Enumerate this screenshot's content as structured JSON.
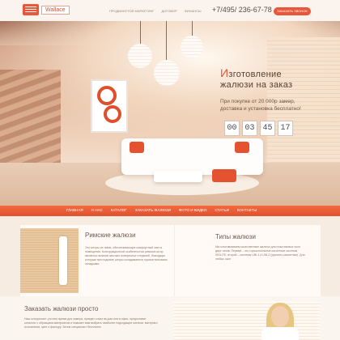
{
  "header": {
    "logo_text": "Wallace",
    "nav": [
      "ПРОДВИНУТОЙ МАРКЕТИНГ",
      "ДОГОВОР",
      "ФИНАНСЫ"
    ],
    "phone": "+7/495/ 236-67-78",
    "call_button": "ЗАКАЗАТЬ ЗВОНОК"
  },
  "hero": {
    "title_line1_accent": "И",
    "title_line1_rest": "зготовление",
    "title_line2": "жалюзи на заказ",
    "subtitle": "При покупке от 20 000р замер, доставка и установка бесплатно!",
    "timer": [
      "00",
      "03",
      "45",
      "17"
    ]
  },
  "mainnav": {
    "items": [
      "ГЛАВНАЯ",
      "О НАС",
      "КАТАЛОГ",
      "ЗАКАЗАТЬ ЖАЛЮЗИ",
      "ФОТО И ВИДЕО",
      "СТАТЬИ",
      "КОНТАКТЫ"
    ]
  },
  "roman": {
    "title": "Римские жалюзи",
    "text": "Это шторы из ткани, обеспечивающие комфортный свет в помещении. Конструкционной особенностью римских штор является наличие жестких поперечных стержней, благодаря которым при подъеме шторы складываются горизонтальными складками."
  },
  "types": {
    "title": "Типы жалюзи",
    "text": "Мы изготавливаем качественные жалюзи для пластиковых окон двух типов. Первый – это горизонтальные кассетные системы ISOLITE, второй – системы UNI-1 и UNI-2 (рулонно-кассетные). Для любых окон"
  },
  "order": {
    "title": "Заказать жалюзи просто",
    "text": "Наш консультант уточнит время для замера, приедет к вам на дом или в офис, предоставит каталоги с образцами материалов и поможет вам выбрать наиболее подходящие жалюзи, материал исполнения, цвет и фактуру. Затем специалист бесплатно"
  },
  "colors": {
    "accent": "#e8573a",
    "background": "#f6ece2"
  }
}
